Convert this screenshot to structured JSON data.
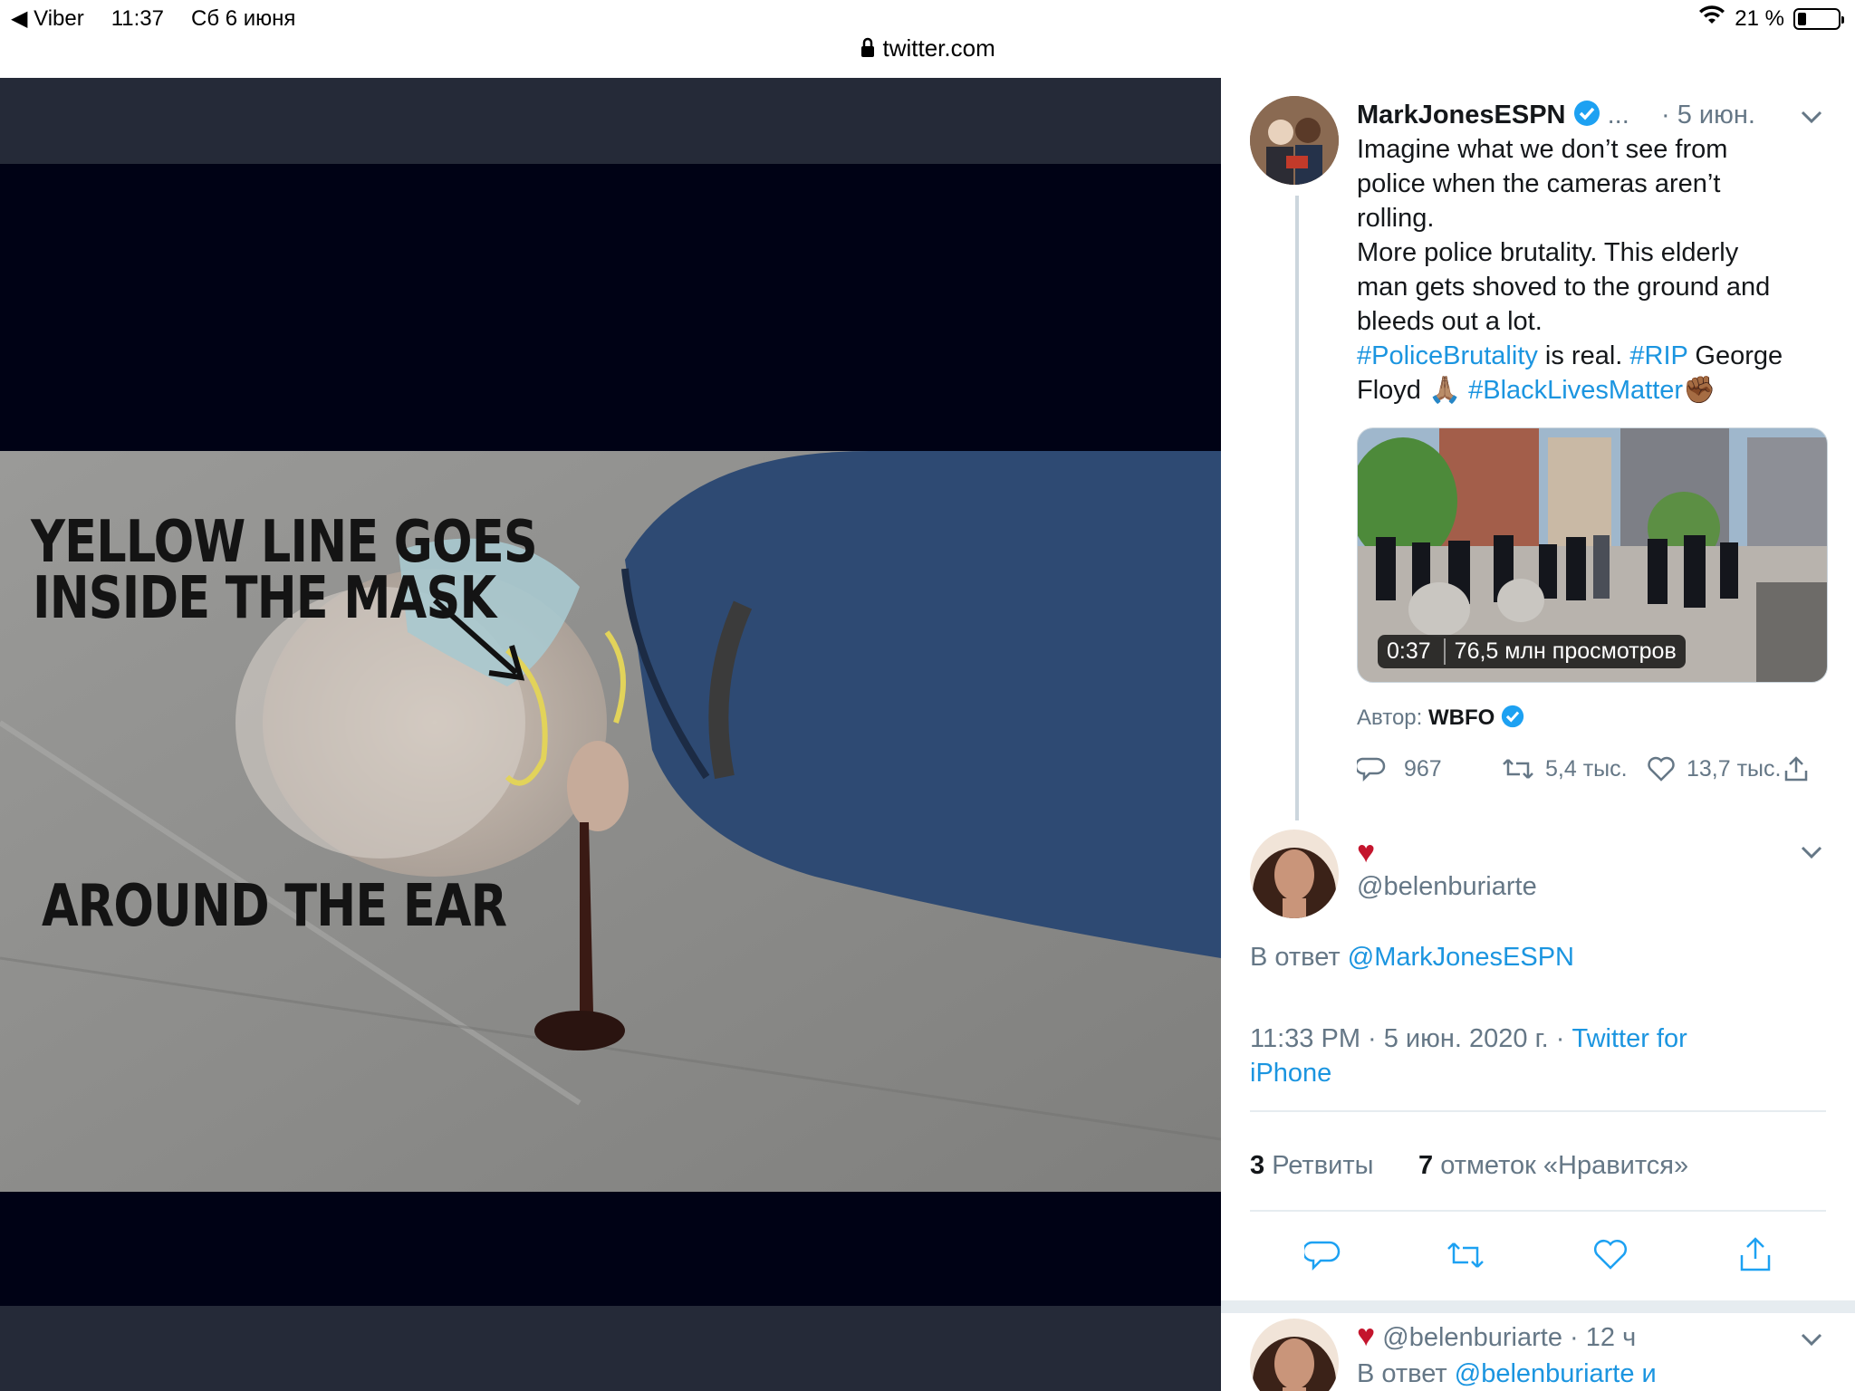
{
  "status_bar": {
    "back_app": "◀ Viber",
    "time": "11:37",
    "date": "Сб 6 июня",
    "battery": "21 %",
    "battery_level": 0.21,
    "url": "twitter.com"
  },
  "media": {
    "caption_line1": "YELLOW LINE GOES",
    "caption_line2": "INSIDE THE MASK",
    "caption_line3": "AROUND THE EAR"
  },
  "tweet": {
    "author": "MarkJonesESPN",
    "ellipsis": "...",
    "date": "· 5 июн.",
    "text_lines": [
      "Imagine what we don’t see from",
      "police when the cameras aren’t",
      "rolling.",
      "More police brutality. This elderly",
      "man gets shoved to the ground and",
      "bleeds out a lot."
    ],
    "hashtag1": "#PoliceBrutality",
    "mid1": " is real. ",
    "hashtag2": "#RIP",
    "mid2": " George",
    "line_floyd": "Floyd 🙏🏽 ",
    "hashtag3": "#BlackLivesMatter",
    "end_emoji": "✊🏾",
    "video_duration": "0:37",
    "video_views": "76,5 млн просмотров",
    "author_label": "Автор: ",
    "author_name": "WBFO",
    "replies": "967",
    "retweets": "5,4 тыс.",
    "likes": "13,7 тыс."
  },
  "reply": {
    "heart": "♥",
    "handle": "@belenburiarte",
    "reply_to_prefix": "В ответ ",
    "reply_to": "@MarkJonesESPN",
    "timestamp": "11:33 PM · 5 июн. 2020 г. · ",
    "source_part1": "Twitter for",
    "source_part2": "iPhone",
    "retweet_count": "3",
    "retweet_label": " Ретвиты",
    "like_count": "7",
    "like_label": " отметок «Нравится»"
  },
  "next_reply": {
    "heart": "♥",
    "handle": "@belenburiarte",
    "time": " · 12 ч",
    "reply_to_prefix": "В ответ ",
    "reply_to": "@belenburiarte и"
  },
  "colors": {
    "link": "#1b95e0",
    "muted": "#657786",
    "heart": "#e0245e",
    "verified": "#1da1f2"
  },
  "icons": [
    "wifi-icon",
    "lock-icon",
    "verified-icon",
    "chevron-down-icon",
    "reply-icon",
    "retweet-icon",
    "like-icon",
    "share-icon"
  ]
}
